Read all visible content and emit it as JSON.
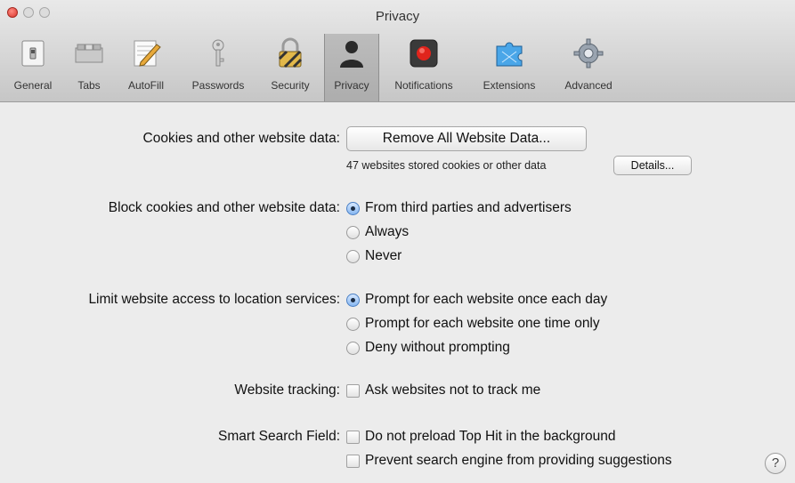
{
  "window": {
    "title": "Privacy"
  },
  "toolbar": {
    "items": [
      {
        "label": "General",
        "icon": "general-switch-icon"
      },
      {
        "label": "Tabs",
        "icon": "tabs-icon"
      },
      {
        "label": "AutoFill",
        "icon": "autofill-pencil-icon"
      },
      {
        "label": "Passwords",
        "icon": "key-icon"
      },
      {
        "label": "Security",
        "icon": "lock-icon"
      },
      {
        "label": "Privacy",
        "icon": "person-silhouette-icon",
        "selected": true
      },
      {
        "label": "Notifications",
        "icon": "notifications-icon"
      },
      {
        "label": "Extensions",
        "icon": "puzzle-icon"
      },
      {
        "label": "Advanced",
        "icon": "gear-icon"
      }
    ]
  },
  "privacy": {
    "cookies": {
      "label": "Cookies and other website data:",
      "remove_button": "Remove All Website Data...",
      "stored_text": "47 websites stored cookies or other data",
      "details_button": "Details..."
    },
    "block_cookies": {
      "label": "Block cookies and other website data:",
      "options": [
        {
          "label": "From third parties and advertisers",
          "selected": true
        },
        {
          "label": "Always",
          "selected": false
        },
        {
          "label": "Never",
          "selected": false
        }
      ]
    },
    "location": {
      "label": "Limit website access to location services:",
      "options": [
        {
          "label": "Prompt for each website once each day",
          "selected": true
        },
        {
          "label": "Prompt for each website one time only",
          "selected": false
        },
        {
          "label": "Deny without prompting",
          "selected": false
        }
      ]
    },
    "tracking": {
      "label": "Website tracking:",
      "checkbox": {
        "label": "Ask websites not to track me",
        "checked": false
      }
    },
    "smart_search": {
      "label": "Smart Search Field:",
      "checkboxes": [
        {
          "label": "Do not preload Top Hit in the background",
          "checked": false
        },
        {
          "label": "Prevent search engine from providing suggestions",
          "checked": false
        }
      ]
    },
    "help_button": "?"
  }
}
